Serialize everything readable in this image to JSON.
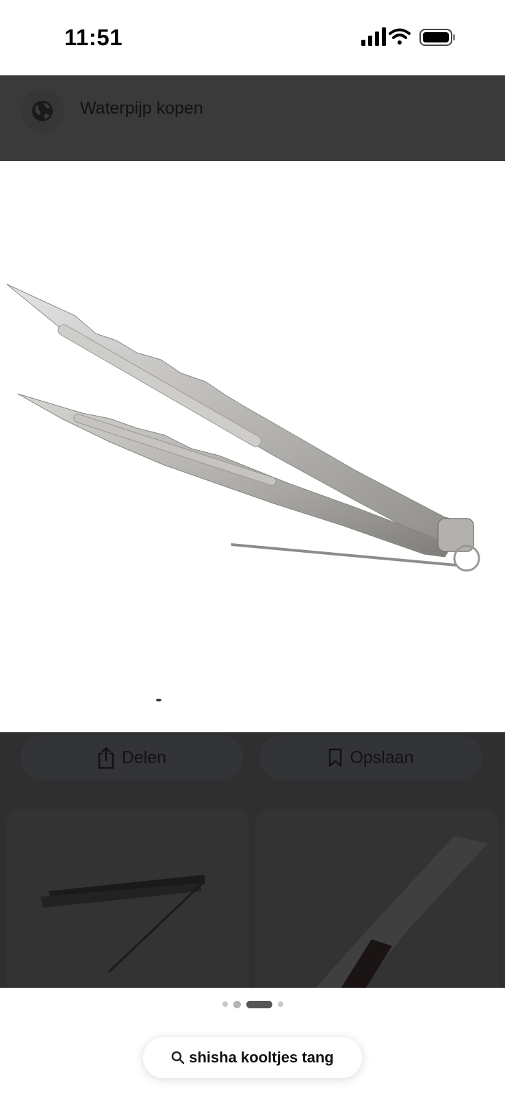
{
  "status_bar": {
    "time": "11:51",
    "icons": [
      "signal-icon",
      "wifi-icon",
      "battery-icon"
    ]
  },
  "header": {
    "icon": "globe-icon",
    "title": "Waterpijp kopen"
  },
  "main_image": {
    "subject": "tongs-image"
  },
  "actions": {
    "share_label": "Delen",
    "share_icon": "share-icon",
    "save_label": "Opslaan",
    "save_icon": "bookmark-icon"
  },
  "thumbnails": [
    "thumbnail-left",
    "thumbnail-right"
  ],
  "pagination": {
    "count": 4,
    "active_index": 2
  },
  "search": {
    "icon": "search-icon",
    "query": "shisha kooltjes tang"
  },
  "colors": {
    "overlay": "#3a3a3a",
    "button_bg": "#333438",
    "page_bg": "#ffffff"
  }
}
